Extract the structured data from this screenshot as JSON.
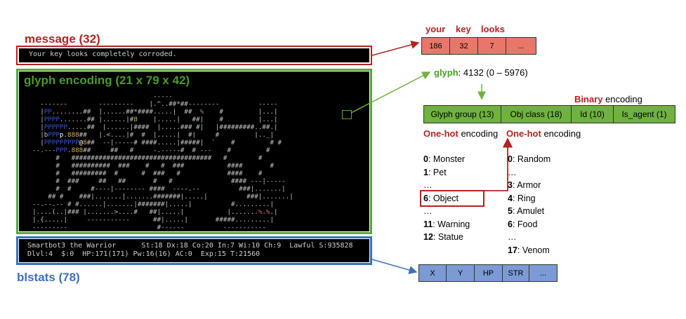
{
  "titles": {
    "message": "message (32)",
    "glyph": "glyph encoding (21 x 79 x 42)",
    "blstats": "blstats (78)"
  },
  "message_text": "Your key looks completely corroded.",
  "map_lines": [
    "                                 -----",
    "    -------        ---------    |.^..##*##--------          -----",
    "    |PP........##  |......##*####.....|  ##  %    #         |...|",
    "    |PPPP.......## |......|#8    |.....|   ##|    #         |...|",
    "    |PPPPPP.....##  |......|####  |.....### #|   |#########..##.|",
    "    |bPPPp.888##   |.<....|#  #  |.....|  #|     #         |.._|",
    "    |PPPPPPPPP@8##  --|-----# ####.....|#####|  `    #         # #",
    "  --.---PPP.888##     ##   #     -.-----#  # ---    #         #",
    "        #   ####################################   #        #",
    "        #   ##########  ###    #   #  ###           ####       #",
    "        #   #########  #      #  ###   #            ####    #",
    "        #  ###     ##   ##       #   #               #### ---|-----",
    "        #  #     #----|-------- ####  ----.--          ###|.......|",
    "      ## #    ###|.......|.......#######|.....|          ###|.......|",
    "  --.--.-- # #......|.......|#######|.....|          #.........|",
    "  |....(..|### |.......>....#   ##|.....|           |.......%.%.|",
    "  |.{.....|     -----------      ##|.....|       #####.........|",
    "  ---------                       #------          -----------"
  ],
  "stats_lines": [
    "Smartbot3 the Warrior      St:18 Dx:18 Co:20 In:7 Wi:10 Ch:9  Lawful S:935828",
    "Dlvl:4  $:0  HP:171(171) Pw:16(16) AC:0  Exp:15 T:21560"
  ],
  "message_encoding": {
    "words": [
      "your",
      "key",
      "looks"
    ],
    "values": [
      "186",
      "32",
      "7",
      "..."
    ]
  },
  "glyph_info": {
    "label": "glyph",
    "value": ": 4132 (0 – 5976)"
  },
  "binary_label": {
    "bold": "Binary",
    "rest": " encoding"
  },
  "glyph_fields": [
    "Glyph group (13)",
    "Obj class (18)",
    "Id (10)",
    "Is_agent (1)"
  ],
  "onehot": {
    "bold": "One-hot",
    "rest": " encoding"
  },
  "glyph_groups": [
    {
      "num": "0",
      "text": ": Monster"
    },
    {
      "num": "1",
      "text": ": Pet"
    },
    {
      "num": "",
      "text": "…"
    },
    {
      "num": "6",
      "text": ": Object"
    },
    {
      "num": "",
      "text": "…"
    },
    {
      "num": "11",
      "text": ": Warning"
    },
    {
      "num": "12",
      "text": ": Statue"
    }
  ],
  "obj_classes": [
    {
      "num": "0",
      "text": ": Random"
    },
    {
      "num": "",
      "text": "…"
    },
    {
      "num": "3",
      "text": ": Armor"
    },
    {
      "num": "4",
      "text": ": Ring"
    },
    {
      "num": "5",
      "text": ": Amulet"
    },
    {
      "num": "6",
      "text": ": Food"
    },
    {
      "num": "",
      "text": "…"
    },
    {
      "num": "17",
      "text": ": Venom"
    }
  ],
  "blstats_fields": [
    "X",
    "Y",
    "HP",
    "STR",
    "..."
  ],
  "colors": {
    "message": "#b22222",
    "glyph": "#5aa63c",
    "blstats": "#3d6fc0",
    "message_cells": "#e8776a",
    "glyph_cells": "#6fb23e",
    "blstats_cells": "#7b9ad6"
  }
}
